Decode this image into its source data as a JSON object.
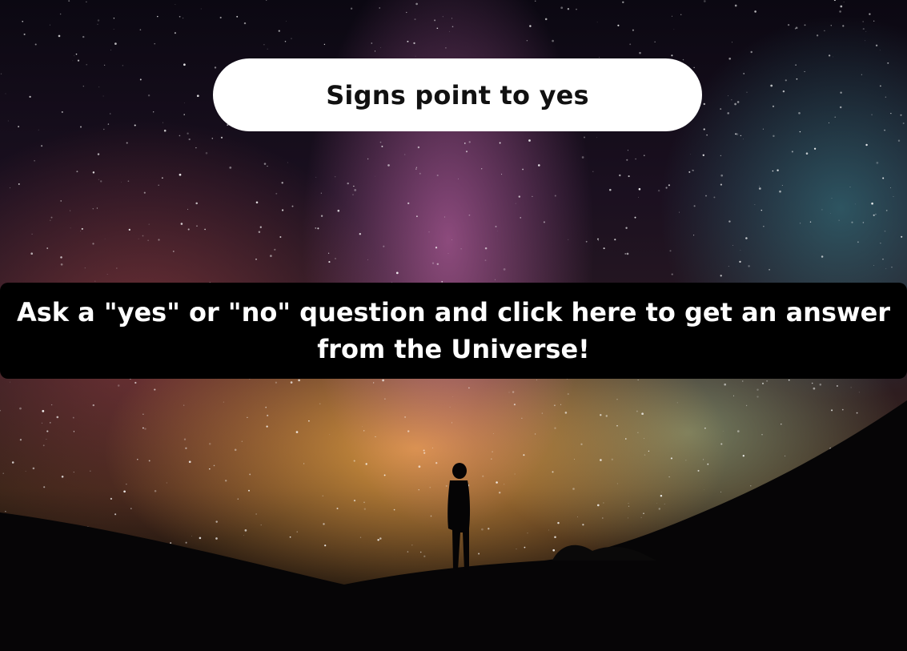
{
  "answer": {
    "text": "Signs point to yes"
  },
  "prompt": {
    "text": "Ask a \"yes\" or \"no\" question and click here to get an answer from the Universe!"
  },
  "background": {
    "scene": "night-sky-milky-way-silhouette"
  },
  "colors": {
    "pill_bg": "#ffffff",
    "band_bg": "#000000",
    "answer_text": "#111111",
    "prompt_text": "#ffffff"
  }
}
